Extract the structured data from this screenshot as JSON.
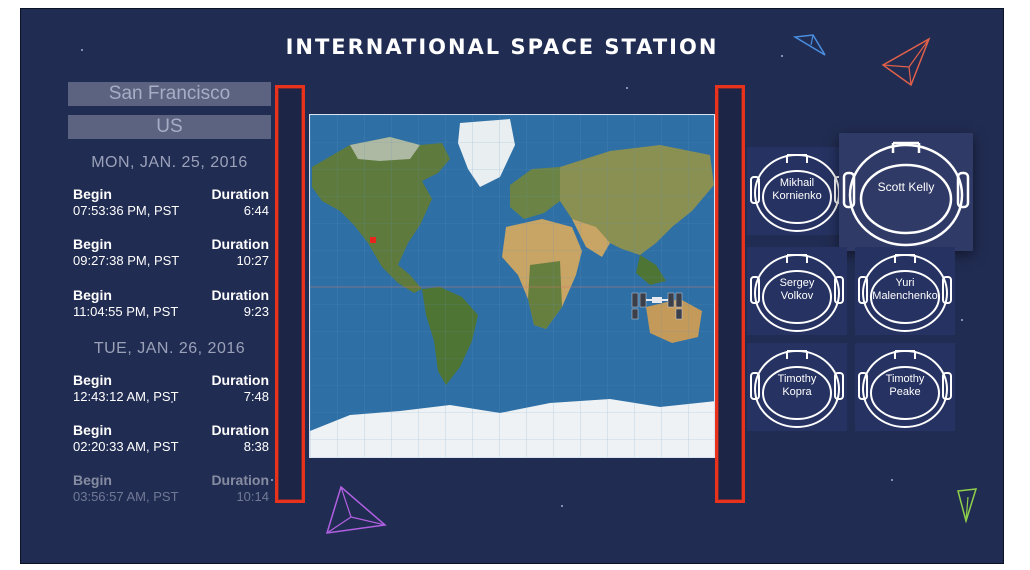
{
  "header": {
    "title": "INTERNATIONAL SPACE STATION"
  },
  "location": {
    "city": "San Francisco",
    "country": "US"
  },
  "schedule": [
    {
      "date": "MON, JAN. 25, 2016",
      "passes": [
        {
          "begin_label": "Begin",
          "time": "07:53:36 PM, PST",
          "duration_label": "Duration",
          "duration": "6:44"
        },
        {
          "begin_label": "Begin",
          "time": "09:27:38 PM, PST",
          "duration_label": "Duration",
          "duration": "10:27"
        },
        {
          "begin_label": "Begin",
          "time": "11:04:55 PM, PST",
          "duration_label": "Duration",
          "duration": "9:23"
        }
      ]
    },
    {
      "date": "TUE, JAN. 26, 2016",
      "passes": [
        {
          "begin_label": "Begin",
          "time": "12:43:12 AM, PST",
          "duration_label": "Duration",
          "duration": "7:48"
        },
        {
          "begin_label": "Begin",
          "time": "02:20:33 AM, PST",
          "duration_label": "Duration",
          "duration": "8:38"
        },
        {
          "begin_label": "Begin",
          "time": "03:56:57 AM, PST",
          "duration_label": "Duration",
          "duration": "10:14"
        }
      ]
    }
  ],
  "map": {
    "marker_color": "#e8241c",
    "ocean_color": "#2d6ea3"
  },
  "astronauts": [
    {
      "line1": "Mikhail",
      "line2": "Kornienko"
    },
    {
      "line1": "Scott Kelly",
      "line2": ""
    },
    {
      "line1": "Sergey",
      "line2": "Volkov"
    },
    {
      "line1": "Yuri",
      "line2": "Malenchenko"
    },
    {
      "line1": "Timothy",
      "line2": "Kopra"
    },
    {
      "line1": "Timothy",
      "line2": "Peake"
    }
  ],
  "decor": {
    "accent_red": "#e8321c",
    "triangle_colors": [
      "#4a8fe0",
      "#e0604a",
      "#b05fe0",
      "#8fd04a"
    ]
  }
}
